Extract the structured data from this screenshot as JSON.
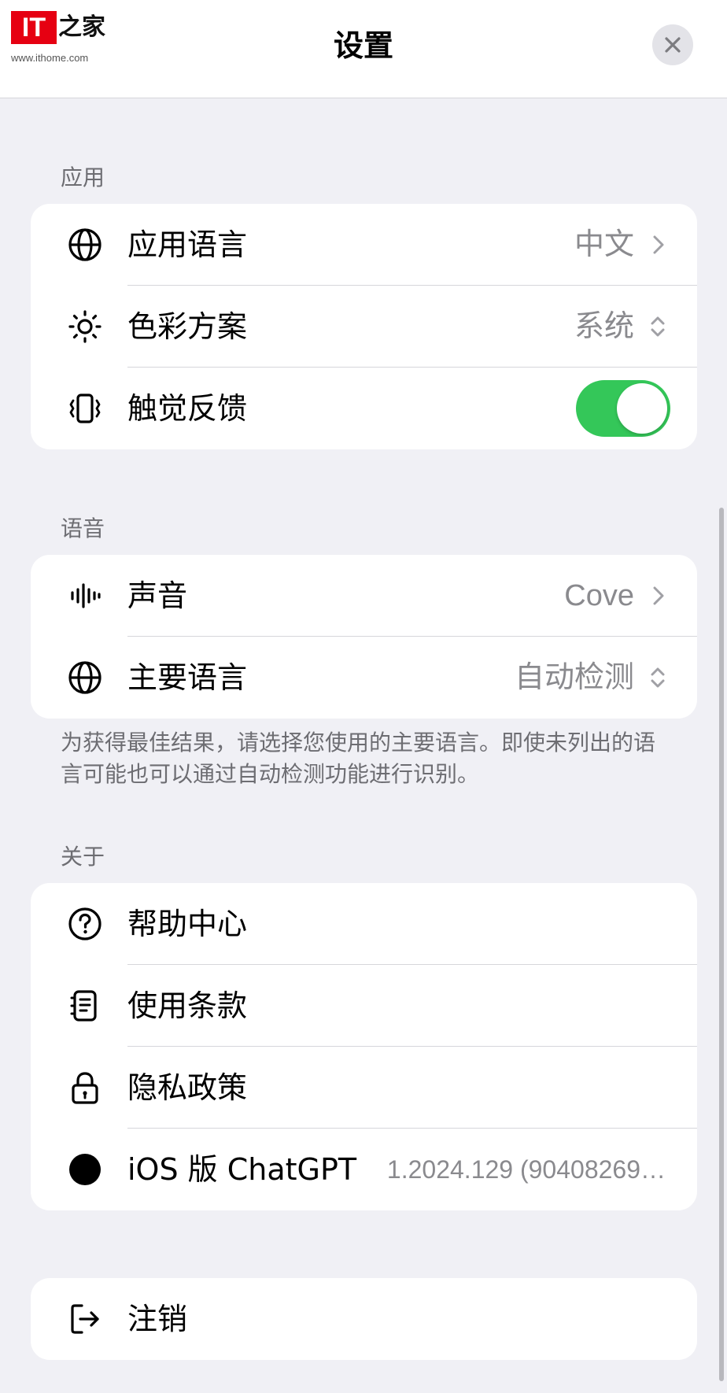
{
  "header": {
    "logo_text": "IT",
    "logo_cn": "之家",
    "logo_url": "www.ithome.com",
    "title": "设置",
    "close_icon": "close-icon"
  },
  "sections": {
    "app": {
      "title": "应用",
      "rows": {
        "language": {
          "label": "应用语言",
          "value": "中文",
          "icon": "globe-icon"
        },
        "color": {
          "label": "色彩方案",
          "value": "系统",
          "icon": "sun-icon"
        },
        "haptic": {
          "label": "触觉反馈",
          "icon": "vibration-icon",
          "toggle_on": true
        }
      }
    },
    "voice": {
      "title": "语音",
      "rows": {
        "sound": {
          "label": "声音",
          "value": "Cove",
          "icon": "waveform-icon"
        },
        "main_language": {
          "label": "主要语言",
          "value": "自动检测",
          "icon": "globe-icon"
        }
      },
      "footnote": "为获得最佳结果，请选择您使用的主要语言。即使未列出的语言可能也可以通过自动检测功能进行识别。"
    },
    "about": {
      "title": "关于",
      "rows": {
        "help": {
          "label": "帮助中心",
          "icon": "help-circle-icon"
        },
        "terms": {
          "label": "使用条款",
          "icon": "document-icon"
        },
        "privacy": {
          "label": "隐私政策",
          "icon": "lock-icon"
        },
        "version": {
          "label": "iOS 版 ChatGPT",
          "value": "1.2024.129 (90408269…",
          "icon": "dot-icon"
        }
      }
    },
    "logout": {
      "label": "注销",
      "icon": "logout-icon"
    }
  },
  "colors": {
    "background": "#f0f0f5",
    "toggle_on": "#34c759",
    "secondary_text": "#8a8a8e",
    "logo_red": "#e60012"
  }
}
